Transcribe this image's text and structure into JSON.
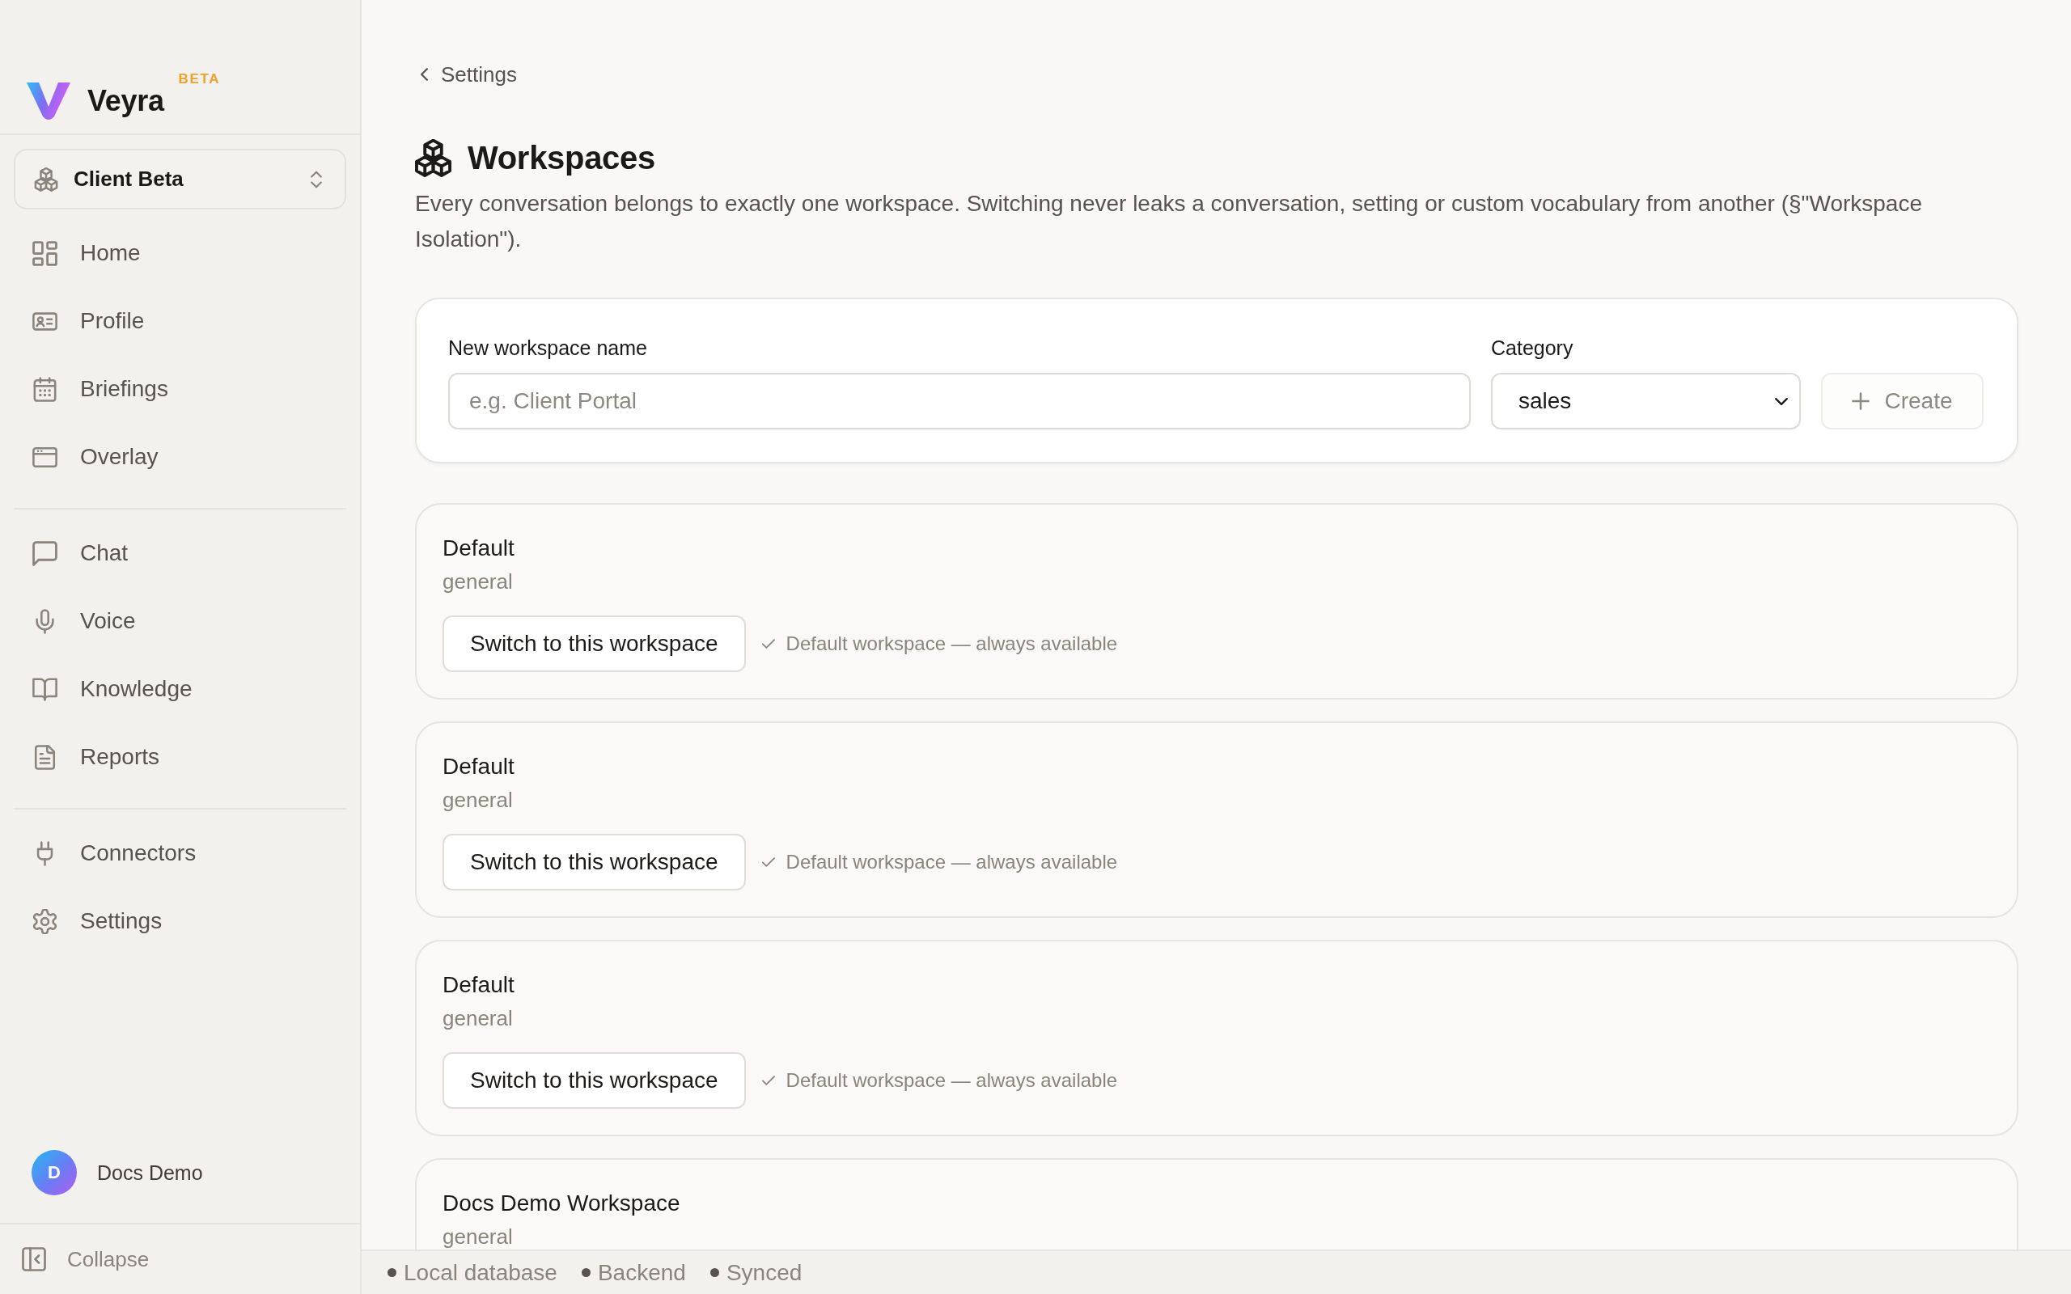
{
  "sidebar": {
    "brand": {
      "name": "Veyra",
      "badge": "BETA"
    },
    "workspace_switcher": {
      "label": "Client Beta"
    },
    "nav_groups": [
      {
        "items": [
          {
            "label": "Home"
          },
          {
            "label": "Profile"
          },
          {
            "label": "Briefings"
          },
          {
            "label": "Overlay"
          }
        ]
      },
      {
        "items": [
          {
            "label": "Chat"
          },
          {
            "label": "Voice"
          },
          {
            "label": "Knowledge"
          },
          {
            "label": "Reports"
          }
        ]
      },
      {
        "items": [
          {
            "label": "Connectors"
          },
          {
            "label": "Settings"
          }
        ]
      }
    ],
    "user": {
      "initial": "D",
      "name": "Docs Demo"
    },
    "collapse_button": {
      "label": "Collapse"
    }
  },
  "main": {
    "back_link": {
      "label": "Settings"
    },
    "title": "Workspaces",
    "description": "Every conversation belongs to exactly one workspace. Switching never leaks a conversation, setting or custom vocabulary from another (§\"Workspace Isolation\").",
    "create_form": {
      "name_field": {
        "label": "New workspace name",
        "placeholder": "e.g. Client Portal"
      },
      "category_field": {
        "label": "Category",
        "value": "sales"
      },
      "create_button": {
        "label": "Create",
        "disabled": true
      }
    },
    "workspaces": [
      {
        "name": "Default",
        "category": "general",
        "switch_button": "Switch to this workspace",
        "note": "Default workspace — always available"
      },
      {
        "name": "Default",
        "category": "general",
        "switch_button": "Switch to this workspace",
        "note": "Default workspace — always available"
      },
      {
        "name": "Default",
        "category": "general",
        "switch_button": "Switch to this workspace",
        "note": "Default workspace — always available"
      },
      {
        "name": "Docs Demo Workspace",
        "category": "general"
      }
    ]
  },
  "status_bar": {
    "items": [
      {
        "label": "Local database"
      },
      {
        "label": "Backend"
      },
      {
        "label": "Synced"
      }
    ]
  }
}
